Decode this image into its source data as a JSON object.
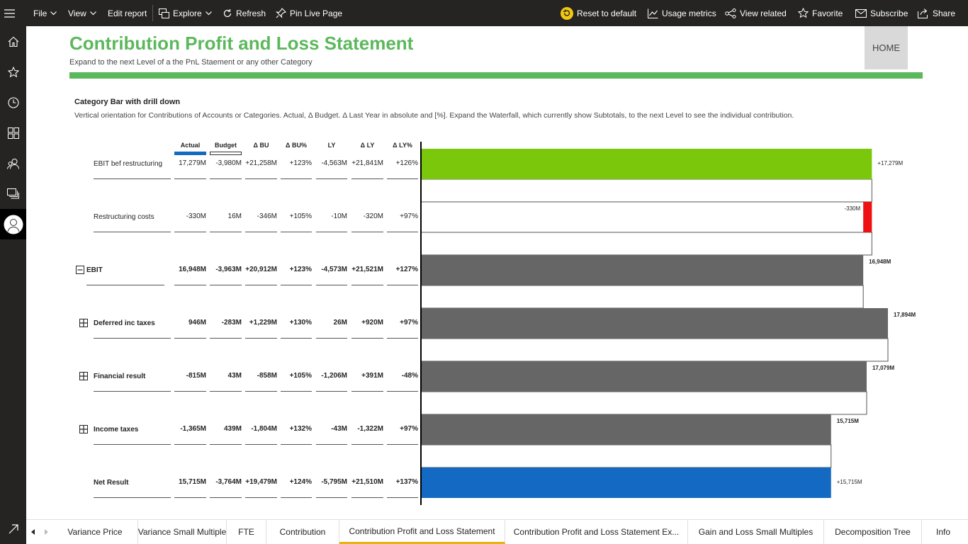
{
  "topbar": {
    "file": "File",
    "view": "View",
    "edit_report": "Edit report",
    "explore": "Explore",
    "refresh": "Refresh",
    "pin_live": "Pin Live Page",
    "reset": "Reset to default",
    "usage": "Usage metrics",
    "view_related": "View related",
    "favorite": "Favorite",
    "subscribe": "Subscribe",
    "share": "Share"
  },
  "header": {
    "title": "Contribution Profit and Loss Statement",
    "subtitle": "Expand to the next Level of a the PnL Staement or any other Category",
    "home_button": "HOME",
    "accent": "#5cb85c"
  },
  "section": {
    "title": "Category Bar with drill down",
    "description": "Vertical orientation for Contributions of Accounts or Categories. Actual, Δ Budget. Δ Last Year in absolute and [%]. Expand the Waterfall, which currently show Subtotals, to the next Level to see the individual contribution."
  },
  "table": {
    "columns": [
      "Actual",
      "Budget",
      "Δ BU",
      "Δ BU%",
      "LY",
      "Δ LY",
      "Δ LY%"
    ],
    "rows": [
      {
        "label": "EBIT bef restructuring",
        "bold": false,
        "expand": "",
        "values": [
          "17,279M",
          "-3,980M",
          "+21,258M",
          "+123%",
          "-4,563M",
          "+21,841M",
          "+126%"
        ]
      },
      {
        "label": "Restructuring costs",
        "bold": false,
        "expand": "",
        "values": [
          "-330M",
          "16M",
          "-346M",
          "+105%",
          "-10M",
          "-320M",
          "+97%"
        ]
      },
      {
        "label": "EBIT",
        "bold": true,
        "expand": "minus",
        "values": [
          "16,948M",
          "-3,963M",
          "+20,912M",
          "+123%",
          "-4,573M",
          "+21,521M",
          "+127%"
        ]
      },
      {
        "label": "Deferred inc taxes",
        "bold": true,
        "expand": "plus",
        "values": [
          "946M",
          "-283M",
          "+1,229M",
          "+130%",
          "26M",
          "+920M",
          "+97%"
        ]
      },
      {
        "label": "Financial result",
        "bold": true,
        "expand": "plus",
        "values": [
          "-815M",
          "43M",
          "-858M",
          "+105%",
          "-1,206M",
          "+391M",
          "-48%"
        ]
      },
      {
        "label": "Income taxes",
        "bold": true,
        "expand": "plus",
        "values": [
          "-1,365M",
          "439M",
          "-1,804M",
          "+132%",
          "-43M",
          "-1,322M",
          "+97%"
        ]
      },
      {
        "label": "Net Result",
        "bold": true,
        "expand": "",
        "values": [
          "15,715M",
          "-3,764M",
          "+19,479M",
          "+124%",
          "-5,795M",
          "+21,510M",
          "+137%"
        ]
      }
    ]
  },
  "chart_data": {
    "type": "bar",
    "orientation": "horizontal-waterfall",
    "categories": [
      "EBIT bef restructuring",
      "Restructuring costs",
      "EBIT",
      "Deferred inc taxes",
      "Financial result",
      "Income taxes",
      "Net Result"
    ],
    "bars": [
      {
        "start": 0,
        "end": 17279,
        "label": "+17,279M",
        "kind": "start",
        "color": "#7ac70c"
      },
      {
        "start": 16948,
        "end": 17279,
        "label": "-330M",
        "kind": "negative",
        "color": "#ee1111"
      },
      {
        "start": 0,
        "end": 16948,
        "label": "16,948M",
        "kind": "subtotal",
        "color": "#666666"
      },
      {
        "start": 0,
        "end": 17894,
        "label": "17,894M",
        "kind": "subtotal",
        "color": "#666666"
      },
      {
        "start": 0,
        "end": 17079,
        "label": "17,079M",
        "kind": "subtotal",
        "color": "#666666"
      },
      {
        "start": 0,
        "end": 15715,
        "label": "15,715M",
        "kind": "subtotal",
        "color": "#666666"
      },
      {
        "start": 0,
        "end": 15715,
        "label": "+15,715M",
        "kind": "total",
        "color": "#1469c2"
      }
    ],
    "xlim": [
      0,
      17894
    ]
  },
  "tabs": [
    "Variance Price",
    "Variance Small Multiple",
    "FTE",
    "Contribution",
    "Contribution Profit and Loss Statement",
    "Contribution Profit and Loss Statement Ex...",
    "Gain and Loss Small Multiples",
    "Decomposition Tree",
    "Info"
  ],
  "active_tab": "Contribution Profit and Loss Statement"
}
